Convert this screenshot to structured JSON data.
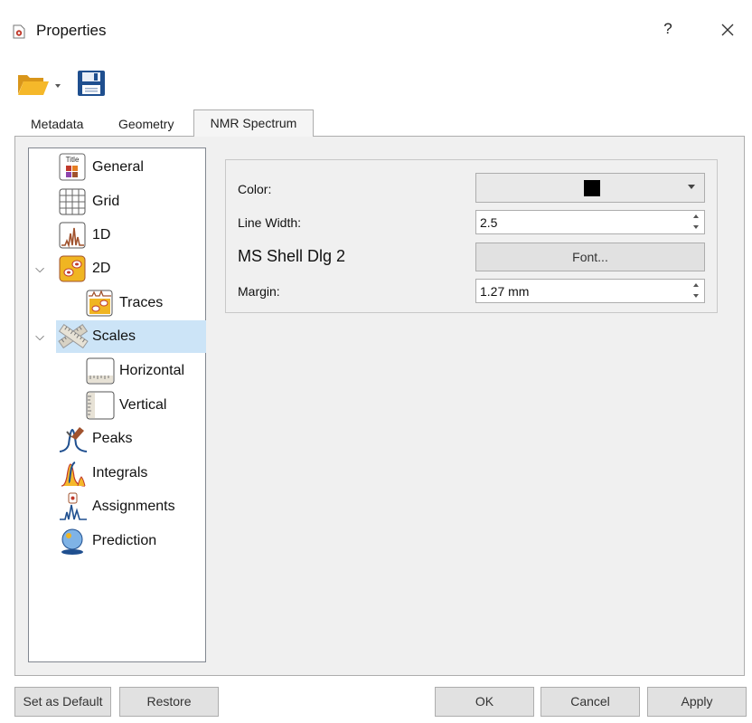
{
  "window": {
    "title": "Properties",
    "help": "?",
    "close_icon": "close-icon",
    "app_icon": "properties-doc-icon"
  },
  "toolbar": {
    "open_icon": "folder-open-icon",
    "save_icon": "floppy-save-icon"
  },
  "tabs": [
    {
      "label": "Metadata",
      "active": false
    },
    {
      "label": "Geometry",
      "active": false
    },
    {
      "label": "NMR Spectrum",
      "active": true
    }
  ],
  "tree": {
    "items": [
      {
        "label": "General",
        "icon": "title-general-icon"
      },
      {
        "label": "Grid",
        "icon": "grid-icon"
      },
      {
        "label": "1D",
        "icon": "spectrum-1d-icon"
      },
      {
        "label": "2D",
        "icon": "spectrum-2d-icon",
        "expanded": true
      },
      {
        "label": "Traces",
        "icon": "traces-icon"
      },
      {
        "label": "Scales",
        "icon": "scales-ruler-icon",
        "expanded": true,
        "selected": true
      },
      {
        "label": "Horizontal",
        "icon": "horizontal-scale-icon"
      },
      {
        "label": "Vertical",
        "icon": "vertical-scale-icon"
      },
      {
        "label": "Peaks",
        "icon": "peaks-icon"
      },
      {
        "label": "Integrals",
        "icon": "integrals-icon"
      },
      {
        "label": "Assignments",
        "icon": "assignments-icon"
      },
      {
        "label": "Prediction",
        "icon": "prediction-icon"
      }
    ]
  },
  "settings": {
    "color_label": "Color:",
    "color_value": "#000000",
    "line_width_label": "Line Width:",
    "line_width_value": "2.5",
    "font_name": "MS Shell Dlg 2",
    "font_button": "Font...",
    "margin_label": "Margin:",
    "margin_value": "1.27 mm"
  },
  "buttons": {
    "set_default": "Set as Default",
    "restore": "Restore",
    "ok": "OK",
    "cancel": "Cancel",
    "apply": "Apply"
  },
  "colors": {
    "selection": "#cce4f7",
    "panel": "#f0f0f0",
    "folder": "#f0b522",
    "save": "#1f4f8f"
  }
}
